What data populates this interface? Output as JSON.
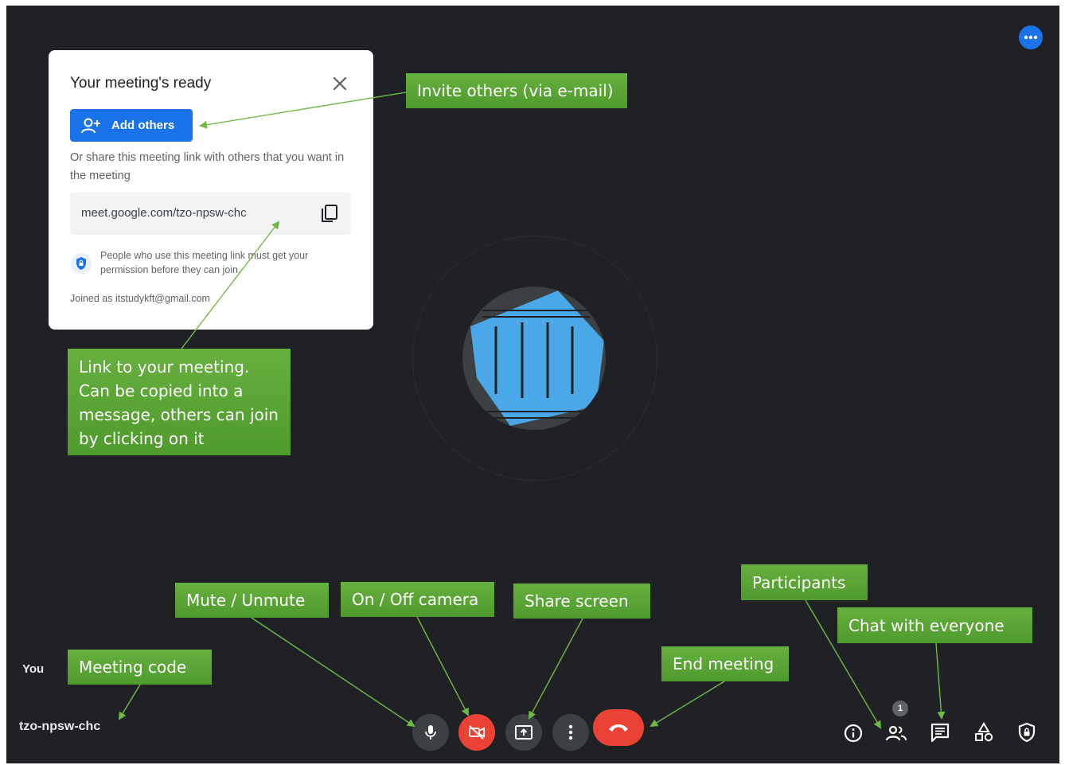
{
  "meeting_card": {
    "title": "Your meeting's ready",
    "add_others_label": "Add others",
    "share_text": "Or share this meeting link with others that you want in the meeting",
    "meeting_link": "meet.google.com/tzo-npsw-chc",
    "permission_text": "People who use this meeting link must get your permission before they can join.",
    "joined_as": "Joined as itstudykft@gmail.com"
  },
  "self_tile": {
    "name": "You",
    "meeting_code": "tzo-npsw-chc"
  },
  "participants_badge": "1",
  "callouts": {
    "invite": "Invite others (via e-mail)",
    "link": "Link to your meeting.\nCan be copied into a\nmessage, others can join\nby clicking on it",
    "mute": "Mute / Unmute",
    "camera": "On / Off camera",
    "share": "Share screen",
    "participants": "Participants",
    "chat": "Chat with everyone",
    "end": "End meeting",
    "code": "Meeting code"
  },
  "colors": {
    "background": "#202124",
    "accent_blue": "#1a73e8",
    "danger_red": "#ea4335",
    "callout_green": "#5fa83a",
    "avatar_blue": "#4aa7e8"
  },
  "icons": {
    "more": "more-horiz-icon",
    "close": "close-icon",
    "add_person": "person-add-icon",
    "copy": "copy-icon",
    "shield": "shield-lock-icon",
    "mic": "mic-icon",
    "camera_off": "videocam-off-icon",
    "present": "present-screen-icon",
    "more_vert": "more-vert-icon",
    "hangup": "call-end-icon",
    "info": "info-icon",
    "people": "people-icon",
    "chat": "chat-icon",
    "activities": "activities-icon",
    "host_controls": "host-controls-icon"
  }
}
